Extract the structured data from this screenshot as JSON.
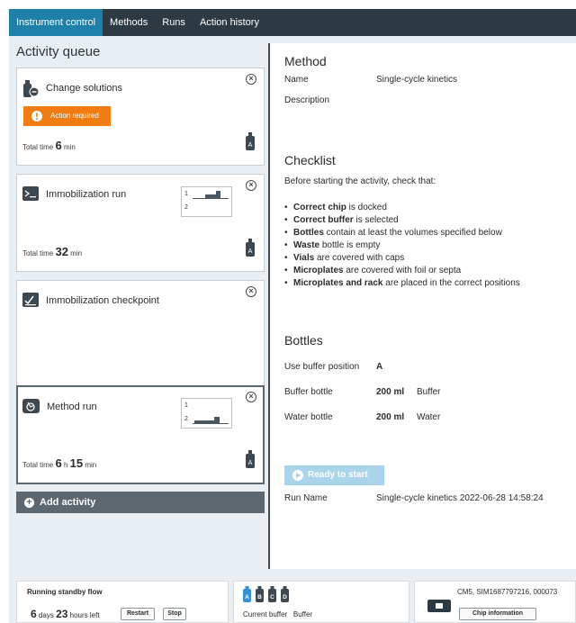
{
  "nav": {
    "tabs": [
      {
        "label": "Instrument control",
        "active": true
      },
      {
        "label": "Methods"
      },
      {
        "label": "Runs"
      },
      {
        "label": "Action history"
      }
    ]
  },
  "queue": {
    "title": "Activity queue",
    "add_activity": "Add activity",
    "cards": [
      {
        "title": "Change solutions",
        "action_required": "Action required",
        "total_prefix": "Total time",
        "time_value": "6",
        "time_unit": "min",
        "bottle": "A"
      },
      {
        "title": "Immobilization run",
        "total_prefix": "Total time",
        "time_value": "32",
        "time_unit": "min",
        "bottle": "A",
        "graph_rows": [
          "1",
          "2"
        ]
      },
      {
        "title": "Immobilization checkpoint"
      },
      {
        "title": "Method run",
        "total_prefix": "Total time",
        "time_h": "6",
        "h_unit": "h",
        "time_m": "15",
        "m_unit": "min",
        "bottle": "A",
        "graph_rows": [
          "1",
          "2"
        ]
      }
    ]
  },
  "method": {
    "heading": "Method",
    "name_label": "Name",
    "name_value": "Single-cycle kinetics",
    "description_label": "Description"
  },
  "checklist": {
    "heading": "Checklist",
    "intro": "Before starting the activity, check that:",
    "items": [
      {
        "bold": "Correct chip",
        "rest": " is docked"
      },
      {
        "bold": "Correct buffer",
        "rest": " is selected"
      },
      {
        "bold": "Bottles",
        "rest": " contain at least the volumes specified below"
      },
      {
        "bold": "Waste",
        "rest": " bottle is empty"
      },
      {
        "bold": "Vials",
        "rest": " are covered with caps"
      },
      {
        "bold": "Microplates",
        "rest": " are covered with foil or septa"
      },
      {
        "bold": "Microplates and rack",
        "rest": " are placed in the correct positions"
      }
    ]
  },
  "bottles": {
    "heading": "Bottles",
    "buffer_position_label": "Use buffer position",
    "buffer_position_value": "A",
    "buffer_bottle_label": "Buffer bottle",
    "buffer_bottle_volume": "200 ml",
    "buffer_bottle_name": "Buffer",
    "water_bottle_label": "Water bottle",
    "water_bottle_volume": "200 ml",
    "water_bottle_name": "Water"
  },
  "run": {
    "ready_button": "Ready to start",
    "run_name_label": "Run Name",
    "run_name_value": "Single-cycle kinetics 2022-06-28 14:58:24"
  },
  "status": {
    "flow_title": "Running standby flow",
    "days_value": "6",
    "days_unit": "days",
    "hours_value": "23",
    "hours_unit": "hours",
    "left_label": "left",
    "restart_label": "Restart",
    "stop_label": "Stop",
    "buffers": [
      "A",
      "B",
      "C",
      "D"
    ],
    "current_buffer_label": "Current buffer",
    "current_buffer_value": "Buffer",
    "chip_id": "CM5, SIM1687797216, 000073",
    "chip_info_label": "Chip information"
  },
  "colors": {
    "nav_bg": "#2e3a43",
    "nav_active": "#1e7fa8",
    "action_required": "#f07c12",
    "ready_button": "#a9d4ea",
    "buffer_active": "#3a8fd0"
  },
  "icons": {
    "close": "close-circle-icon",
    "warning": "warning-icon",
    "bottle": "bottle-icon",
    "plus": "plus-circle-icon",
    "play": "play-circle-icon",
    "chip": "chip-icon"
  }
}
